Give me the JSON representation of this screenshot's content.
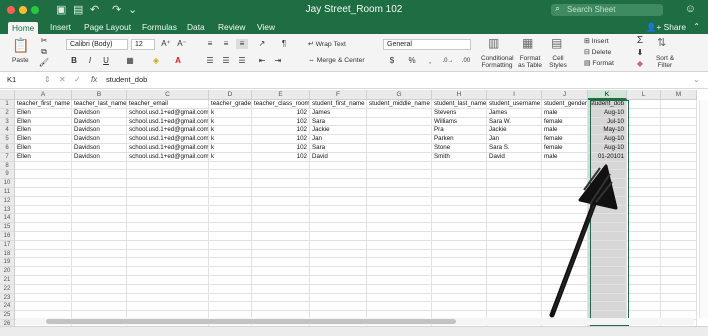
{
  "window": {
    "title": "Jay Street_Room 102",
    "search_placeholder": "Search Sheet"
  },
  "ribbon_tabs": [
    "Home",
    "Insert",
    "Page Layout",
    "Formulas",
    "Data",
    "Review",
    "View"
  ],
  "share_label": "Share",
  "ribbon": {
    "paste_label": "Paste",
    "font_name": "Calibri (Body)",
    "font_size": "12",
    "bold": "B",
    "italic": "I",
    "underline": "U",
    "wrap_text": "Wrap Text",
    "merge_center": "Merge & Center",
    "number_format": "General",
    "currency": "$",
    "percent": "%",
    "comma": ",",
    "conditional_formatting": [
      "Conditional",
      "Formatting"
    ],
    "format_as_table": [
      "Format",
      "as Table"
    ],
    "cell_styles": [
      "Cell",
      "Styles"
    ],
    "insert": "Insert",
    "delete": "Delete",
    "format": "Format",
    "sort_filter": [
      "Sort &",
      "Filter"
    ]
  },
  "formula_bar": {
    "name_box": "K1",
    "fx": "fx",
    "content": "student_dob"
  },
  "grid": {
    "columns": [
      "A",
      "B",
      "C",
      "D",
      "E",
      "F",
      "G",
      "H",
      "I",
      "J",
      "K",
      "L",
      "M"
    ],
    "selected_column": "K",
    "row_numbers": [
      "1",
      "2",
      "3",
      "4",
      "5",
      "6",
      "7",
      "8",
      "9",
      "10",
      "11",
      "12",
      "13",
      "14",
      "15",
      "16",
      "17",
      "18",
      "19",
      "20",
      "21",
      "22",
      "23",
      "24",
      "25",
      "26"
    ],
    "rows": [
      [
        "teacher_first_name",
        "teacher_last_name",
        "teacher_email",
        "teacher_grade",
        "teacher_class_room",
        "student_first_name",
        "student_middle_name",
        "student_last_name",
        "student_username",
        "student_gender",
        "student_dob",
        "",
        ""
      ],
      [
        "Ellen",
        "Davidson",
        "school.usd.1+ed@gmail.com",
        "k",
        "102",
        "James",
        "",
        "Stevens",
        "James",
        "male",
        "Aug-10",
        "",
        ""
      ],
      [
        "Ellen",
        "Davidson",
        "school.usd.1+ed@gmail.com",
        "k",
        "102",
        "Sara",
        "",
        "Williams",
        "Sara W.",
        "female",
        "Jul-10",
        "",
        ""
      ],
      [
        "Ellen",
        "Davidson",
        "school.usd.1+ed@gmail.com",
        "k",
        "102",
        "Jackie",
        "",
        "Pra",
        "Jackie",
        "male",
        "May-10",
        "",
        ""
      ],
      [
        "Ellen",
        "Davidson",
        "school.usd.1+ed@gmail.com",
        "k",
        "102",
        "Jan",
        "",
        "Parken",
        "Jan",
        "female",
        "Aug-10",
        "",
        ""
      ],
      [
        "Ellen",
        "Davidson",
        "school.usd.1+ed@gmail.com",
        "k",
        "102",
        "Sara",
        "",
        "Stone",
        "Sara S.",
        "female",
        "Aug-10",
        "",
        ""
      ],
      [
        "Ellen",
        "Davidson",
        "school.usd.1+ed@gmail.com",
        "k",
        "102",
        "David",
        "",
        "Smith",
        "David",
        "male",
        "01-20101",
        "",
        ""
      ]
    ]
  },
  "colors": {
    "excel_green": "#1f6e43",
    "selection_fill": "#d6d6d6"
  }
}
